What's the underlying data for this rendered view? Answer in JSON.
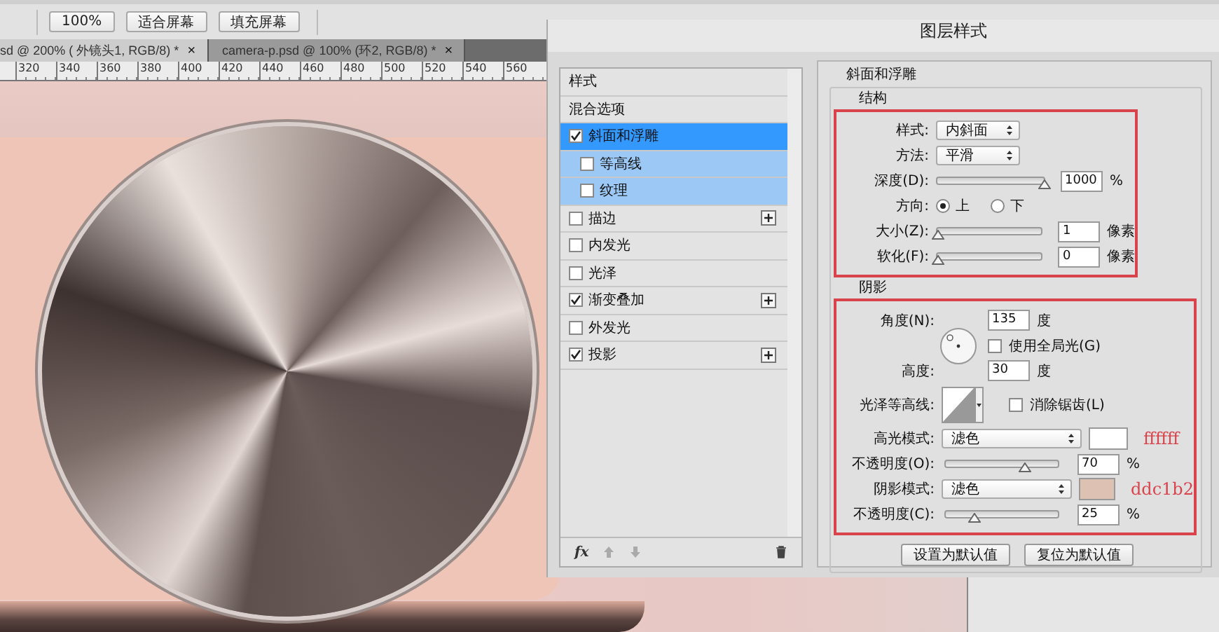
{
  "toolbar": {
    "buttons": [
      "100%",
      "适合屏幕",
      "填充屏幕"
    ]
  },
  "document_tabs": [
    {
      "label": "sd @ 200% ( 外镜头1, RGB/8) *",
      "close": "×",
      "selected": true
    },
    {
      "label": "camera-p.psd @ 100% (环2, RGB/8) *",
      "close": "×",
      "selected": false
    }
  ],
  "ruler": {
    "ticks": [
      "320",
      "340",
      "360",
      "380",
      "400",
      "420",
      "440",
      "460",
      "480",
      "500",
      "520",
      "540",
      "560"
    ]
  },
  "dialog": {
    "title": "图层样式",
    "styles_list": {
      "items": [
        {
          "kind": "header",
          "label": "样式"
        },
        {
          "kind": "plain",
          "label": "混合选项"
        },
        {
          "kind": "effect",
          "label": "斜面和浮雕",
          "checked": true,
          "selected": true,
          "add": false,
          "children": [
            {
              "kind": "effect",
              "label": "等高线",
              "checked": false,
              "selected": false,
              "add": false
            },
            {
              "kind": "effect",
              "label": "纹理",
              "checked": false,
              "selected": false,
              "add": false
            }
          ]
        },
        {
          "kind": "effect",
          "label": "描边",
          "checked": false,
          "selected": false,
          "add": true
        },
        {
          "kind": "effect",
          "label": "内发光",
          "checked": false,
          "selected": false,
          "add": false
        },
        {
          "kind": "effect",
          "label": "光泽",
          "checked": false,
          "selected": false,
          "add": false
        },
        {
          "kind": "effect",
          "label": "渐变叠加",
          "checked": true,
          "selected": false,
          "add": true
        },
        {
          "kind": "effect",
          "label": "外发光",
          "checked": false,
          "selected": false,
          "add": false
        },
        {
          "kind": "effect",
          "label": "投影",
          "checked": true,
          "selected": false,
          "add": true
        }
      ],
      "fx_label": "fx"
    },
    "bevel": {
      "title": "斜面和浮雕",
      "structure": {
        "title": "结构",
        "rows": [
          {
            "kind": "select",
            "label": "样式:",
            "value": "内斜面"
          },
          {
            "kind": "select",
            "label": "方法:",
            "value": "平滑"
          },
          {
            "kind": "slider",
            "label": "深度(D):",
            "level": 1,
            "value": "1000",
            "unit": "%"
          },
          {
            "kind": "radio",
            "label": "方向:",
            "options": [
              {
                "label": "上",
                "selected": true
              },
              {
                "label": "下",
                "selected": false
              }
            ]
          },
          {
            "kind": "slider",
            "label": "大小(Z):",
            "level": 0,
            "value": "1",
            "unit": "像素"
          },
          {
            "kind": "slider",
            "label": "软化(F):",
            "level": 0,
            "value": "0",
            "unit": "像素"
          }
        ]
      },
      "shading": {
        "title": "阴影",
        "rows": [
          {
            "kind": "angle",
            "label": "角度(N):",
            "value": "135",
            "unit": "度",
            "global_light": {
              "label": "使用全局光(G)",
              "checked": false
            },
            "altitude_label": "高度:",
            "altitude": "30",
            "altitude_unit": "度"
          },
          {
            "kind": "contour",
            "label": "光泽等高线:",
            "anti_alias": {
              "label": "消除锯齿(L)",
              "checked": false
            }
          },
          {
            "kind": "mode",
            "label": "高光模式:",
            "value": "滤色",
            "color": "#ffffff",
            "note": "ffffff"
          },
          {
            "kind": "slider",
            "label": "不透明度(O):",
            "level": 0.7,
            "value": "70",
            "unit": "%"
          },
          {
            "kind": "mode",
            "label": "阴影模式:",
            "value": "滤色",
            "color": "#ddc1b2",
            "note": "ddc1b2"
          },
          {
            "kind": "slider",
            "label": "不透明度(C):",
            "level": 0.25,
            "value": "25",
            "unit": "%"
          }
        ]
      }
    },
    "buttons": [
      "设置为默认值",
      "复位为默认值"
    ]
  }
}
